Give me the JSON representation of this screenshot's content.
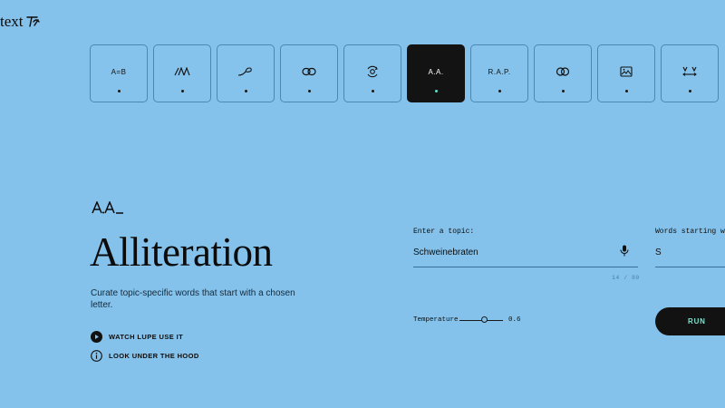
{
  "app": {
    "logo_text": "text"
  },
  "tools": [
    {
      "glyph": "A=B",
      "icon": "equivalence-icon",
      "active": false
    },
    {
      "glyph": "",
      "icon": "slash-triangles-icon",
      "active": false
    },
    {
      "glyph": "",
      "icon": "curve-line-icon",
      "active": false
    },
    {
      "glyph": "",
      "icon": "link-icon",
      "active": false
    },
    {
      "glyph": "",
      "icon": "orbit-eye-icon",
      "active": false
    },
    {
      "glyph": "A.A.",
      "icon": "alliteration-icon",
      "active": true
    },
    {
      "glyph": "R.A.P.",
      "icon": "acronym-icon",
      "active": false
    },
    {
      "glyph": "",
      "icon": "overlap-circles-icon",
      "active": false
    },
    {
      "glyph": "",
      "icon": "image-caption-icon",
      "active": false
    },
    {
      "glyph": "",
      "icon": "opposites-icon",
      "active": false
    }
  ],
  "main": {
    "title": "Alliteration",
    "description": "Curate topic-specific words that start with a chosen letter.",
    "links": [
      {
        "label": "WATCH LUPE USE IT",
        "icon": "play-icon"
      },
      {
        "label": "LOOK UNDER THE HOOD",
        "icon": "info-icon"
      }
    ]
  },
  "form": {
    "topic_label": "Enter a topic:",
    "topic_value": "Schweinebraten",
    "counter": "14 / 80",
    "letter_label": "Words starting wi",
    "letter_value": "S",
    "temperature_label": "Temperature",
    "temperature_value": "0.6",
    "temperature_level": 0.6,
    "run_label": "RUN"
  },
  "colors": {
    "background": "#84c2eb",
    "active_tool": "#131313",
    "accent": "#7ee3cf"
  }
}
